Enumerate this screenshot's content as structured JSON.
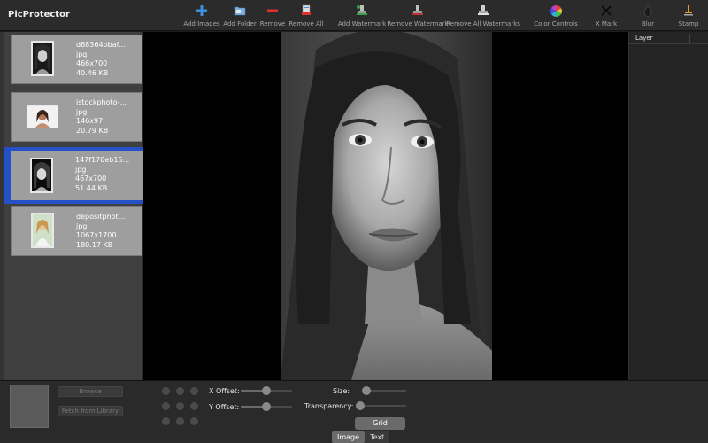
{
  "app": {
    "title": "PicProtector"
  },
  "toolbar": {
    "items": [
      {
        "label": "Add Images",
        "icon": "plus-icon",
        "color": "#3d8fe0"
      },
      {
        "label": "Add Folder",
        "icon": "folder-icon",
        "color": "#7fb0e0"
      },
      {
        "label": "Remove",
        "icon": "minus-icon",
        "color": "#e03030"
      },
      {
        "label": "Remove All",
        "icon": "remove-all-icon",
        "color": "#e03030"
      },
      {
        "label": "Add Watermark",
        "icon": "stamp-add-icon",
        "color": "#3aa04a"
      },
      {
        "label": "Remove Watermark",
        "icon": "stamp-remove-icon",
        "color": "#c03030"
      },
      {
        "label": "Remove All Watermarks",
        "icon": "stamp-remove-all-icon",
        "color": "#c0c0c0"
      },
      {
        "label": "Color Controls",
        "icon": "color-wheel-icon",
        "color": "#e05090"
      },
      {
        "label": "X Mark",
        "icon": "x-mark-icon",
        "color": "#111111"
      },
      {
        "label": "Blur",
        "icon": "droplet-icon",
        "color": "#222222"
      },
      {
        "label": "Stamp",
        "icon": "stamp-icon",
        "color": "#e0a020"
      }
    ]
  },
  "files": [
    {
      "name": "d68364bbaf...",
      "type": "jpg",
      "dimensions": "466x700",
      "size": "40.46 KB"
    },
    {
      "name": "istockphoto-...",
      "type": "jpg",
      "dimensions": "146x97",
      "size": "20.79 KB"
    },
    {
      "name": "147f170eb15...",
      "type": "jpg",
      "dimensions": "467x700",
      "size": "51.44 KB"
    },
    {
      "name": "depositphot...",
      "type": "jpg",
      "dimensions": "1067x1700",
      "size": "180.17 KB"
    }
  ],
  "selected_file_index": 2,
  "selection_color": "#2450c8",
  "right_panel": {
    "header": "Layer"
  },
  "bottom": {
    "browse_label": "Browse",
    "fetch_label": "Fetch from Library",
    "x_offset_label": "X Offset:",
    "y_offset_label": "Y Offset:",
    "size_label": "Size:",
    "transparency_label": "Transparency:",
    "grid_label": "Grid",
    "x_offset_value": 0.5,
    "y_offset_value": 0.5,
    "size_value": 0.0,
    "transparency_value": 0.0,
    "tabs": [
      {
        "label": "Image",
        "active": true
      },
      {
        "label": "Text",
        "active": false
      }
    ]
  }
}
